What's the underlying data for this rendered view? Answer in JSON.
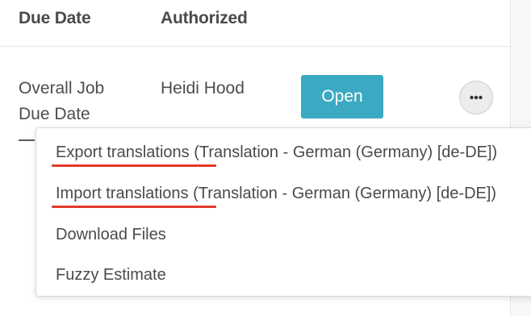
{
  "table": {
    "headers": {
      "due_date": "Due Date",
      "authorized": "Authorized"
    },
    "row": {
      "due_date_line1": "Overall Job",
      "due_date_line2": "Due Date",
      "authorized": "Heidi Hood",
      "open_label": "Open"
    }
  },
  "menu": {
    "items": [
      {
        "label": "Export translations (Translation - German (Germany) [de-DE])",
        "highlighted": true
      },
      {
        "label": "Import translations (Translation - German (Germany) [de-DE])",
        "highlighted": true
      },
      {
        "label": "Download Files",
        "highlighted": false
      },
      {
        "label": "Fuzzy Estimate",
        "highlighted": false
      }
    ]
  },
  "icons": {
    "more": "more-horizontal-icon"
  },
  "colors": {
    "primary_button": "#3aa9c1",
    "highlight_underline": "#e23b2a",
    "text": "#4a4a4a"
  }
}
